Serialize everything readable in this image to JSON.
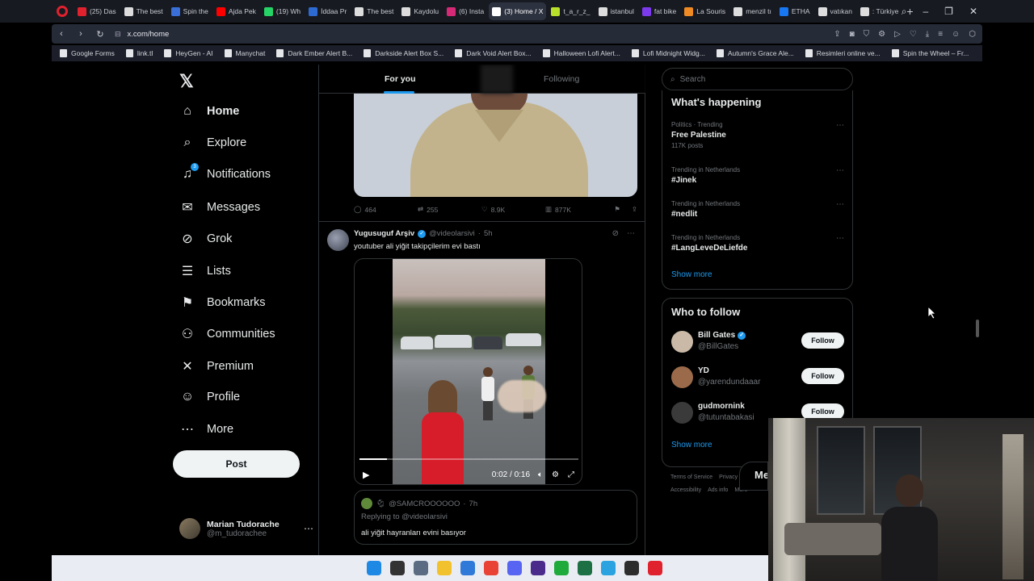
{
  "browser": {
    "tabs": [
      {
        "label": "(25) Das",
        "color": "#e0212e"
      },
      {
        "label": "The best",
        "color": "#dddddd"
      },
      {
        "label": "Spin the",
        "color": "#3b6fd8"
      },
      {
        "label": "Ajda Pek",
        "color": "#ff0000"
      },
      {
        "label": "(19) Wh",
        "color": "#25d366"
      },
      {
        "label": "İddaa Pr",
        "color": "#2d6bd3"
      },
      {
        "label": "The best",
        "color": "#dddddd"
      },
      {
        "label": "Kaydolu",
        "color": "#dddddd"
      },
      {
        "label": "(6) Insta",
        "color": "#d62976"
      },
      {
        "label": "(3) Home / X",
        "color": "#ffffff",
        "active": true
      },
      {
        "label": "t_a_r_z_",
        "color": "#b8e02a"
      },
      {
        "label": "istanbul",
        "color": "#dddddd"
      },
      {
        "label": "fat bike",
        "color": "#7c3aed"
      },
      {
        "label": "La Souris",
        "color": "#f08a24"
      },
      {
        "label": "menzil tı",
        "color": "#dddddd"
      },
      {
        "label": "ETHA",
        "color": "#1877f2"
      },
      {
        "label": "vatıkan",
        "color": "#dddddd"
      },
      {
        "label": ": Türkiye",
        "color": "#dddddd"
      }
    ],
    "url": "x.com/home",
    "bookmarks": [
      "Google Forms",
      "link.tl",
      "HeyGen - AI",
      "Manychat",
      "Dark Ember Alert B...",
      "Darkside Alert Box S...",
      "Dark Void Alert Box...",
      "Halloween Lofi Alert...",
      "Lofi Midnight Widg...",
      "Autumn's Grace Ale...",
      "Resimleri online ve...",
      "Spin the Wheel – Fr..."
    ]
  },
  "nav": {
    "items": [
      {
        "label": "Home",
        "icon": "home-icon",
        "glyph": "⌂"
      },
      {
        "label": "Explore",
        "icon": "search-icon",
        "glyph": "⌕"
      },
      {
        "label": "Notifications",
        "icon": "bell-icon",
        "glyph": "♫",
        "badge": "3"
      },
      {
        "label": "Messages",
        "icon": "envelope-icon",
        "glyph": "✉"
      },
      {
        "label": "Grok",
        "icon": "grok-icon",
        "glyph": "⊘"
      },
      {
        "label": "Lists",
        "icon": "list-icon",
        "glyph": "☰"
      },
      {
        "label": "Bookmarks",
        "icon": "bookmark-icon",
        "glyph": "⚑"
      },
      {
        "label": "Communities",
        "icon": "people-icon",
        "glyph": "⚇"
      },
      {
        "label": "Premium",
        "icon": "x-premium-icon",
        "glyph": "✕"
      },
      {
        "label": "Profile",
        "icon": "person-icon",
        "glyph": "☺"
      },
      {
        "label": "More",
        "icon": "more-circle-icon",
        "glyph": "⋯"
      }
    ],
    "post_label": "Post",
    "account": {
      "name": "Marian Tudorache",
      "handle": "@m_tudorachee"
    }
  },
  "feed": {
    "tabs": [
      "For you",
      "Following"
    ],
    "prev_tweet_stats": {
      "replies": "464",
      "reposts": "255",
      "likes": "8.9K",
      "views": "877K"
    },
    "tweet": {
      "author": "Yugusuguf Arşiv",
      "handle": "@videolarsivi",
      "time": "5h",
      "text": "youtuber ali yiğit takipçilerim evi bastı",
      "video_time": "0:02 / 0:16",
      "video_progress": 0.125
    },
    "quote": {
      "author": "@SAMCROOOOOO",
      "time": "7h",
      "replying_prefix": "Replying to",
      "replying_to": "@videolarsivi",
      "text": "ali yiğit hayranları evini basıyor"
    }
  },
  "sidebar": {
    "search_placeholder": "Search",
    "whats_happening_title": "What's happening",
    "trends": [
      {
        "context": "Politics · Trending",
        "title": "Free Palestine",
        "count": "117K posts"
      },
      {
        "context": "Trending in Netherlands",
        "title": "#Jinek",
        "count": ""
      },
      {
        "context": "Trending in Netherlands",
        "title": "#nedlit",
        "count": ""
      },
      {
        "context": "Trending in Netherlands",
        "title": "#LangLeveDeLiefde",
        "count": ""
      }
    ],
    "show_more": "Show more",
    "who_to_follow_title": "Who to follow",
    "follow_suggestions": [
      {
        "name": "Bill Gates",
        "handle": "@BillGates",
        "verified": true,
        "avatar_color": "#c9b9a6"
      },
      {
        "name": "YD",
        "handle": "@yarendundaaar",
        "verified": false,
        "avatar_color": "#9a6a4a"
      },
      {
        "name": "gudmornink",
        "handle": "@tutuntabakasi",
        "verified": false,
        "avatar_color": "#3a3a3a"
      }
    ],
    "follow_label": "Follow",
    "footer": [
      "Terms of Service",
      "Privacy Policy",
      "Accessibility",
      "Ads info",
      "More"
    ],
    "messages_stub": "Me"
  },
  "colors": {
    "accent": "#1d9bf0",
    "background": "#000000",
    "muted": "#71767b",
    "border": "#2f3336"
  },
  "taskbar_icons": [
    {
      "name": "windows-start-icon",
      "color": "#1e88e5"
    },
    {
      "name": "search-icon",
      "color": "#333333"
    },
    {
      "name": "settings-icon",
      "color": "#5a6b82"
    },
    {
      "name": "file-explorer-icon",
      "color": "#f2c12e"
    },
    {
      "name": "photos-icon",
      "color": "#2f7ad8"
    },
    {
      "name": "chrome-icon",
      "color": "#e84335"
    },
    {
      "name": "discord-icon",
      "color": "#5865f2"
    },
    {
      "name": "obs-icon",
      "color": "#4a2a8a"
    },
    {
      "name": "app-green-icon",
      "color": "#1faa3c"
    },
    {
      "name": "excel-icon",
      "color": "#1d7044"
    },
    {
      "name": "telegram-icon",
      "color": "#2aa3e0"
    },
    {
      "name": "app-dark-icon",
      "color": "#2d2d2d"
    },
    {
      "name": "opera-icon",
      "color": "#e0212e"
    }
  ]
}
